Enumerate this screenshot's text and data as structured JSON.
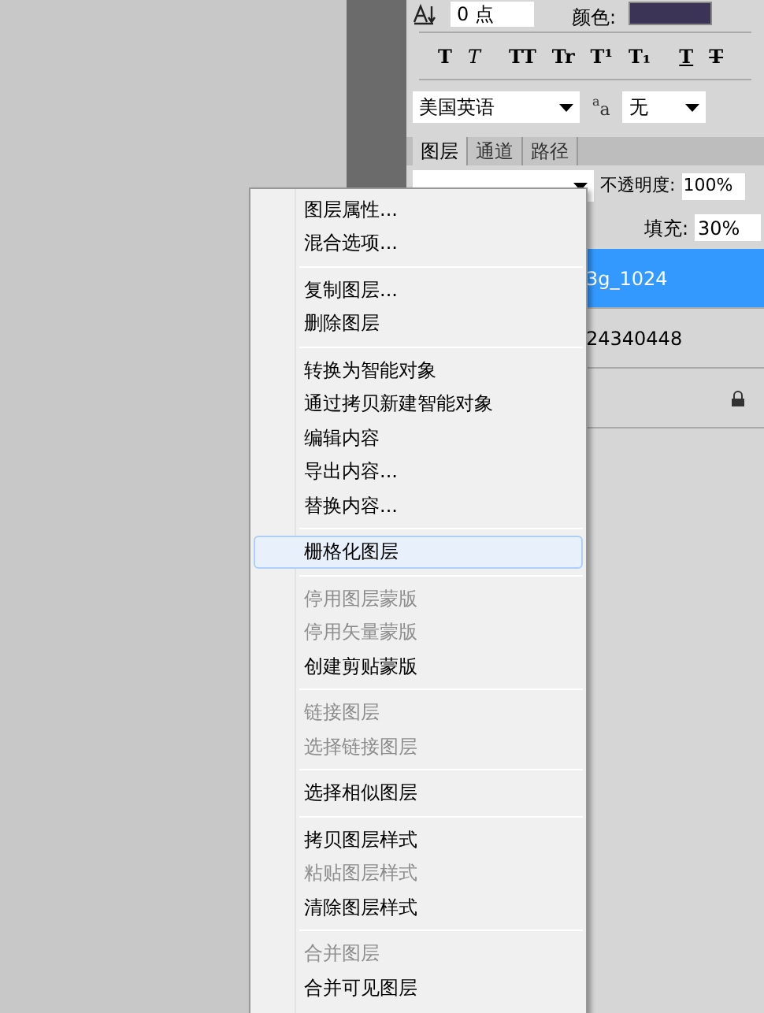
{
  "character": {
    "size_value": "0 点",
    "color_label": "颜色:",
    "color": "#3b3457",
    "styles": [
      "T",
      "T",
      "TT",
      "Tr",
      "T¹",
      "T₁",
      "T",
      "T"
    ],
    "language": "美国英语",
    "antialias_glyph": [
      "a",
      "a"
    ],
    "antialias": "无"
  },
  "tabs": [
    {
      "label": "图层",
      "selected": true
    },
    {
      "label": "通道",
      "selected": false
    },
    {
      "label": "路径",
      "selected": false
    }
  ],
  "opacity_label": "不透明度:",
  "opacity": "100%",
  "fill_label": "填充:",
  "fill": "30%",
  "layers": [
    {
      "name": "3g_1024",
      "selected": true,
      "locked": false
    },
    {
      "name": "24340448",
      "selected": false,
      "locked": false
    },
    {
      "selected": false,
      "locked": true
    }
  ],
  "menu": [
    [
      {
        "label": "图层属性...",
        "disabled": false,
        "selected": false
      },
      {
        "label": "混合选项...",
        "disabled": false,
        "selected": false
      }
    ],
    [
      {
        "label": "复制图层...",
        "disabled": false,
        "selected": false
      },
      {
        "label": "删除图层",
        "disabled": false,
        "selected": false
      }
    ],
    [
      {
        "label": "转换为智能对象",
        "disabled": false,
        "selected": false
      },
      {
        "label": "通过拷贝新建智能对象",
        "disabled": false,
        "selected": false
      },
      {
        "label": "编辑内容",
        "disabled": false,
        "selected": false
      },
      {
        "label": "导出内容...",
        "disabled": false,
        "selected": false
      },
      {
        "label": "替换内容...",
        "disabled": false,
        "selected": false
      }
    ],
    [
      {
        "label": "栅格化图层",
        "disabled": false,
        "selected": true
      }
    ],
    [
      {
        "label": "停用图层蒙版",
        "disabled": true,
        "selected": false
      },
      {
        "label": "停用矢量蒙版",
        "disabled": true,
        "selected": false
      },
      {
        "label": "创建剪贴蒙版",
        "disabled": false,
        "selected": false
      }
    ],
    [
      {
        "label": "链接图层",
        "disabled": true,
        "selected": false
      },
      {
        "label": "选择链接图层",
        "disabled": true,
        "selected": false
      }
    ],
    [
      {
        "label": "选择相似图层",
        "disabled": false,
        "selected": false
      }
    ],
    [
      {
        "label": "拷贝图层样式",
        "disabled": false,
        "selected": false
      },
      {
        "label": "粘贴图层样式",
        "disabled": true,
        "selected": false
      },
      {
        "label": "清除图层样式",
        "disabled": false,
        "selected": false
      }
    ],
    [
      {
        "label": "合并图层",
        "disabled": true,
        "selected": false
      },
      {
        "label": "合并可见图层",
        "disabled": false,
        "selected": false
      }
    ]
  ]
}
